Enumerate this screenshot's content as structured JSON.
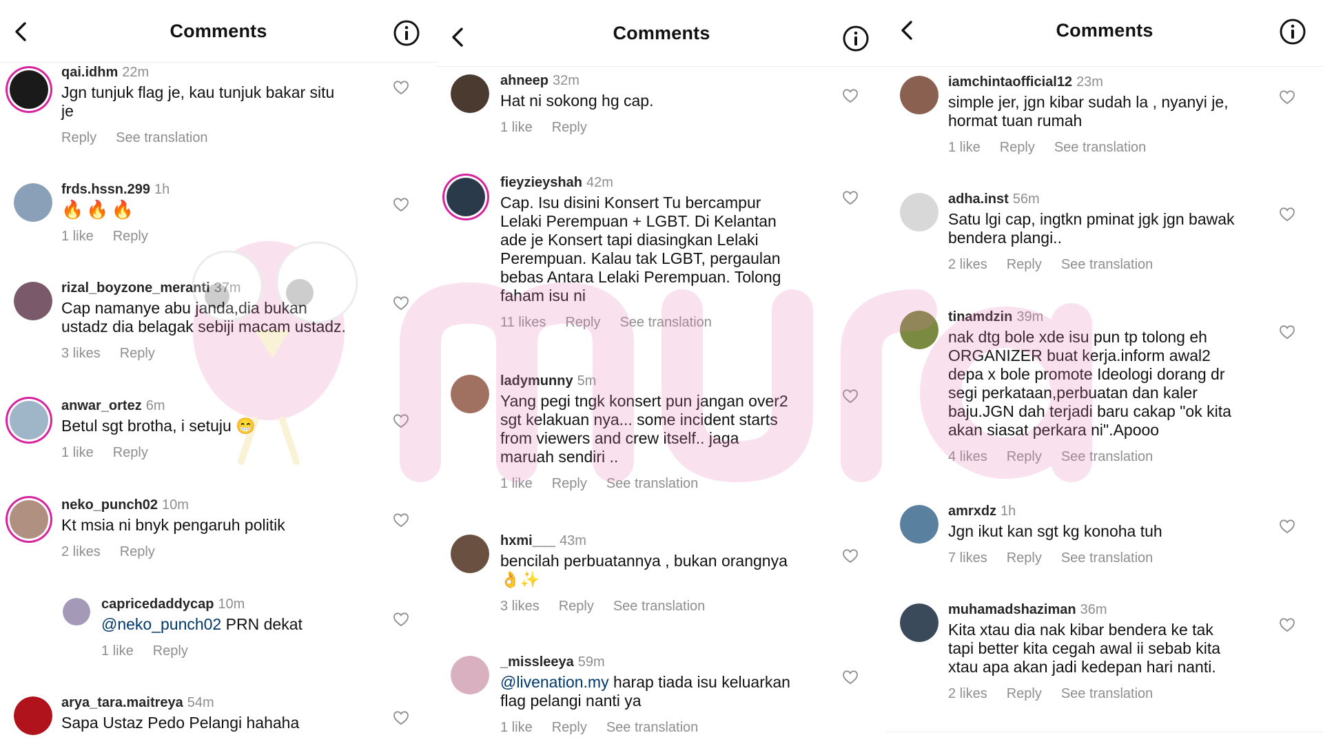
{
  "panels": [
    {
      "title": "Comments",
      "comments": [
        {
          "user": "qai.idhm",
          "time": "22m",
          "text": "Jgn tunjuk flag je, kau tunjuk bakar situ\nje",
          "actions": [
            "Reply",
            "See translation"
          ],
          "avatar_color": "#1a1a1a",
          "ring": true
        },
        {
          "user": "frds.hssn.299",
          "time": "1h",
          "text": "🔥🔥🔥",
          "actions": [
            "1 like",
            "Reply"
          ],
          "avatar_color": "#8aa0b8",
          "ring": false
        },
        {
          "user": "rizal_boyzone_meranti",
          "time": "37m",
          "text": "Cap namanye abu janda,dia bukan\nustadz dia belagak sebiji macam ustadz.",
          "actions": [
            "3 likes",
            "Reply"
          ],
          "avatar_color": "#7a5a6a",
          "ring": false
        },
        {
          "user": "anwar_ortez",
          "time": "6m",
          "text": "Betul sgt brotha, i setuju 😁",
          "actions": [
            "1 like",
            "Reply"
          ],
          "avatar_color": "#9fb6c9",
          "ring": true
        },
        {
          "user": "neko_punch02",
          "time": "10m",
          "text": "Kt msia ni bnyk pengaruh politik",
          "actions": [
            "2 likes",
            "Reply"
          ],
          "avatar_color": "#b09080",
          "ring": true
        },
        {
          "user": "capricedaddycap",
          "time": "10m",
          "mention": "@neko_punch02",
          "text": " PRN dekat",
          "actions": [
            "1 like",
            "Reply"
          ],
          "avatar_color": "#a49ab8",
          "ring": false,
          "reply": true
        },
        {
          "user": "arya_tara.maitreya",
          "time": "54m",
          "text": "Sapa Ustaz Pedo Pelangi hahaha",
          "actions": [],
          "avatar_color": "#b0131b",
          "ring": false
        }
      ]
    },
    {
      "title": "Comments",
      "comments": [
        {
          "user": "ahneep",
          "time": "32m",
          "text": "Hat ni sokong hg cap.",
          "actions": [
            "1 like",
            "Reply"
          ],
          "avatar_color": "#4a3a30",
          "ring": false
        },
        {
          "user": "fieyzieyshah",
          "time": "42m",
          "text": "Cap. Isu disini Konsert Tu bercampur\nLelaki Perempuan + LGBT. Di Kelantan\nade je Konsert tapi diasingkan Lelaki\nPerempuan. Kalau tak LGBT, pergaulan\nbebas Antara Lelaki Perempuan. Tolong\nfaham isu ni",
          "actions": [
            "11 likes",
            "Reply",
            "See translation"
          ],
          "avatar_color": "#2b3a4a",
          "ring": true
        },
        {
          "user": "ladymunny",
          "time": "5m",
          "text": "Yang pegi tngk konsert pun jangan over2\nsgt kelakuan nya... some incident starts\nfrom viewers and crew itself.. jaga\nmaruah sendiri ..",
          "actions": [
            "1 like",
            "Reply",
            "See translation"
          ],
          "avatar_color": "#a07060",
          "ring": false
        },
        {
          "user": "hxmi___",
          "time": "43m",
          "text": "bencilah perbuatannya , bukan orangnya\n👌✨",
          "actions": [
            "3 likes",
            "Reply",
            "See translation"
          ],
          "avatar_color": "#6a5040",
          "ring": false
        },
        {
          "user": "_missleeya",
          "time": "59m",
          "mention": "@livenation.my",
          "text": " harap tiada isu keluarkan\nflag pelangi nanti ya",
          "actions": [
            "1 like",
            "Reply",
            "See translation"
          ],
          "avatar_color": "#d9b0c0",
          "ring": false
        }
      ]
    },
    {
      "title": "Comments",
      "comments": [
        {
          "user": "iamchintaofficial12",
          "time": "23m",
          "text": "simple jer, jgn kibar sudah la , nyanyi je,\nhormat tuan rumah",
          "actions": [
            "1 like",
            "Reply",
            "See translation"
          ],
          "avatar_color": "#8a6050",
          "ring": false
        },
        {
          "user": "adha.inst",
          "time": "56m",
          "text": "Satu lgi cap, ingtkn pminat jgk jgn bawak\nbendera plangi..",
          "actions": [
            "2 likes",
            "Reply",
            "See translation"
          ],
          "avatar_color": "#d8d8d8",
          "ring": false
        },
        {
          "user": "tinamdzin",
          "time": "39m",
          "text": "nak dtg bole xde isu pun tp tolong eh\nORGANIZER buat kerja.inform awal2\ndepa x bole promote Ideologi dorang dr\nsegi perkataan,perbuatan dan kaler\nbaju.JGN dah terjadi baru cakap \"ok kita\nakan siasat perkara ni\".Apooo",
          "actions": [
            "4 likes",
            "Reply",
            "See translation"
          ],
          "avatar_color": "#7a8a40",
          "ring": false
        },
        {
          "user": "amrxdz",
          "time": "1h",
          "text": "Jgn ikut kan sgt kg konoha tuh",
          "actions": [
            "7 likes",
            "Reply",
            "See translation"
          ],
          "avatar_color": "#5a80a0",
          "ring": false
        },
        {
          "user": "muhamadshaziman",
          "time": "36m",
          "text": "Kita xtau dia nak kibar bendera ke tak\ntapi better kita cegah awal ii sebab kita\nxtau apa akan jadi kedepan hari nanti.",
          "actions": [
            "2 likes",
            "Reply",
            "See translation"
          ],
          "avatar_color": "#3a4a5a",
          "ring": false
        }
      ]
    }
  ],
  "icons": {
    "back": "chevron-left-icon",
    "info": "info-icon",
    "like": "heart-icon"
  },
  "colors": {
    "username": "#262626",
    "muted": "#8e8e8e",
    "mention": "#00376b",
    "story_ring": "#d6249f"
  }
}
